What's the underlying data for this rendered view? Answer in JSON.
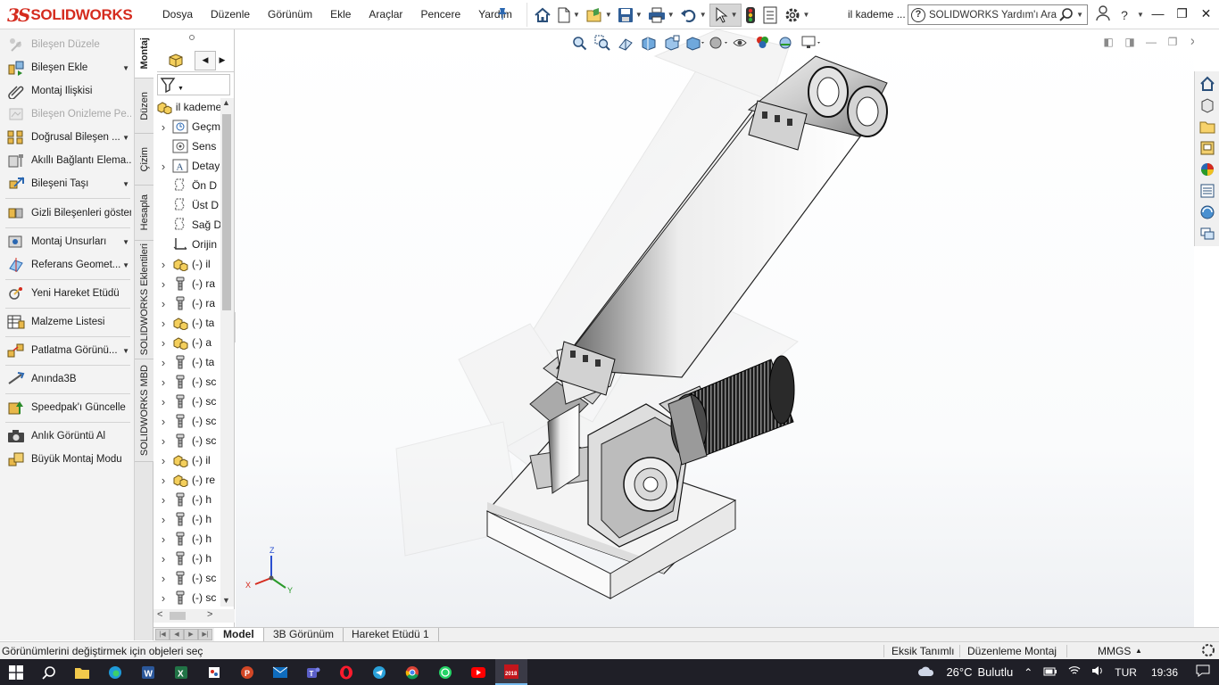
{
  "app": {
    "brand_prefix": "3S",
    "brand_name": "SOLIDWORKS",
    "document_title": "il kademe ...",
    "colors": {
      "brand_red": "#d52b1e",
      "accent_blue": "#2a67b1",
      "taskbar": "#1f1f27"
    }
  },
  "menu": {
    "items": [
      "Dosya",
      "Düzenle",
      "Görünüm",
      "Ekle",
      "Araçlar",
      "Pencere",
      "Yardım"
    ],
    "pin_icon": "pin-icon"
  },
  "quick_access": {
    "icons": [
      "home-icon",
      "new-document-icon",
      "open-icon",
      "save-icon",
      "print-icon",
      "undo-icon",
      "select-pointer-icon",
      "rebuild-traffic-light-icon",
      "file-properties-icon",
      "options-gear-icon"
    ]
  },
  "search": {
    "placeholder": "SOLIDWORKS Yardım'ı Ara",
    "value": "SOLIDWORKS Yardım'ı Ara"
  },
  "window_controls": [
    "minimize",
    "restore",
    "close"
  ],
  "command_manager": {
    "items": [
      {
        "label": "Bileşen Düzele",
        "icon": "edit-component-icon",
        "disabled": true,
        "dropdown": false
      },
      {
        "label": "Bileşen Ekle",
        "icon": "insert-component-icon",
        "disabled": false,
        "dropdown": true
      },
      {
        "label": "Montaj İlişkisi",
        "icon": "mate-paperclip-icon",
        "disabled": false,
        "dropdown": false
      },
      {
        "label": "Bileşen Önizleme Pe...",
        "icon": "component-preview-icon",
        "disabled": true,
        "dropdown": false
      },
      {
        "label": "Doğrusal Bileşen ...",
        "icon": "linear-pattern-icon",
        "disabled": false,
        "dropdown": true
      },
      {
        "label": "Akıllı Bağlantı Elema...",
        "icon": "smart-fasteners-icon",
        "disabled": false,
        "dropdown": false
      },
      {
        "label": "Bileşeni Taşı",
        "icon": "move-component-icon",
        "disabled": false,
        "dropdown": true
      },
      {
        "label": "Gizli Bileşenleri göster",
        "icon": "show-hidden-icon",
        "disabled": false,
        "dropdown": false
      },
      {
        "label": "Montaj Unsurları",
        "icon": "assembly-features-icon",
        "disabled": false,
        "dropdown": true
      },
      {
        "label": "Referans Geomet...",
        "icon": "reference-geometry-icon",
        "disabled": false,
        "dropdown": true
      },
      {
        "label": "Yeni Hareket Etüdü",
        "icon": "motion-study-icon",
        "disabled": false,
        "dropdown": false
      },
      {
        "label": "Malzeme Listesi",
        "icon": "bill-of-materials-icon",
        "disabled": false,
        "dropdown": false
      },
      {
        "label": "Patlatma Görünü...",
        "icon": "exploded-view-icon",
        "disabled": false,
        "dropdown": true
      },
      {
        "label": "Anında3B",
        "icon": "instant3d-icon",
        "disabled": false,
        "dropdown": false
      },
      {
        "label": "Speedpak'ı Güncelle",
        "icon": "speedpak-icon",
        "disabled": false,
        "dropdown": false
      },
      {
        "label": "Anlık Görüntü Al",
        "icon": "snapshot-camera-icon",
        "disabled": false,
        "dropdown": false
      },
      {
        "label": "Büyük Montaj Modu",
        "icon": "large-assembly-icon",
        "disabled": false,
        "dropdown": false
      }
    ]
  },
  "vertical_tabs": [
    "Montaj",
    "Düzen",
    "Çizim",
    "Hesapla",
    "SOLIDWORKS Eklentileri",
    "SOLIDWORKS MBD"
  ],
  "feature_tree": {
    "root_label": "il kademe",
    "items": [
      {
        "expander": true,
        "icon": "history-icon",
        "label": "Geçm"
      },
      {
        "expander": false,
        "icon": "sensors-icon",
        "label": "Sens"
      },
      {
        "expander": true,
        "icon": "annotations-icon",
        "label": "Detay"
      },
      {
        "expander": false,
        "icon": "plane-icon",
        "label": "Ön D"
      },
      {
        "expander": false,
        "icon": "plane-icon",
        "label": "Üst D"
      },
      {
        "expander": false,
        "icon": "plane-icon",
        "label": "Sağ D"
      },
      {
        "expander": false,
        "icon": "origin-icon",
        "label": "Orijin"
      },
      {
        "expander": true,
        "icon": "subassembly-icon",
        "label": "(-) il"
      },
      {
        "expander": true,
        "icon": "part-icon",
        "label": "(-) ra"
      },
      {
        "expander": true,
        "icon": "part-icon",
        "label": "(-) ra"
      },
      {
        "expander": true,
        "icon": "subassembly-icon",
        "label": "(-) ta"
      },
      {
        "expander": true,
        "icon": "subassembly-icon",
        "label": "(-) a"
      },
      {
        "expander": true,
        "icon": "part-icon",
        "label": "(-) ta"
      },
      {
        "expander": true,
        "icon": "part-icon",
        "label": "(-) sc"
      },
      {
        "expander": true,
        "icon": "part-icon",
        "label": "(-) sc"
      },
      {
        "expander": true,
        "icon": "part-icon",
        "label": "(-) sc"
      },
      {
        "expander": true,
        "icon": "part-icon",
        "label": "(-) sc"
      },
      {
        "expander": true,
        "icon": "subassembly-icon",
        "label": "(-) il"
      },
      {
        "expander": true,
        "icon": "subassembly-icon",
        "label": "(-) re"
      },
      {
        "expander": true,
        "icon": "part-icon",
        "label": "(-) h"
      },
      {
        "expander": true,
        "icon": "part-icon",
        "label": "(-) h"
      },
      {
        "expander": true,
        "icon": "part-icon",
        "label": "(-) h"
      },
      {
        "expander": true,
        "icon": "part-icon",
        "label": "(-) h"
      },
      {
        "expander": true,
        "icon": "part-icon",
        "label": "(-) sc"
      },
      {
        "expander": true,
        "icon": "part-icon",
        "label": "(-) sc"
      }
    ]
  },
  "heads_up_toolbar": [
    "zoom-to-fit-icon",
    "zoom-area-icon",
    "previous-view-icon",
    "section-view-icon",
    "dynamic-annotation-icon",
    "view-orientation-icon",
    "display-style-icon",
    "hide-show-icon",
    "edit-appearance-icon",
    "apply-scene-icon",
    "view-settings-icon"
  ],
  "viewport_controls": [
    "split-left",
    "split-right",
    "minimize",
    "restore",
    "close"
  ],
  "task_pane": [
    "solidworks-resources-icon",
    "design-library-icon",
    "file-explorer-icon",
    "view-palette-icon",
    "appearances-icon",
    "custom-properties-icon",
    "solidworks-forum-icon",
    "3dexperience-icon"
  ],
  "triad": {
    "x": "X",
    "y": "Y",
    "z": "Z"
  },
  "bottom_tabs": [
    "Model",
    "3B Görünüm",
    "Hareket Etüdü 1"
  ],
  "status": {
    "message": "Görünümlerini değiştirmek için objeleri seç",
    "definition": "Eksik Tanımlı",
    "mode": "Düzenleme Montaj",
    "units": "MMGS",
    "units_arrow": "▲"
  },
  "taskbar": {
    "apps": [
      "windows-start-icon",
      "search-icon",
      "file-explorer-icon",
      "edge-icon",
      "word-icon",
      "excel-icon",
      "paint-icon",
      "powerpoint-icon",
      "mail-icon",
      "teams-icon",
      "opera-icon",
      "telegram-icon",
      "chrome-icon",
      "whatsapp-icon",
      "youtube-icon",
      "solidworks-2018-icon"
    ],
    "weather": "26°C",
    "weather_text": "Bulutlu",
    "language": "TUR",
    "time": "19:36"
  }
}
